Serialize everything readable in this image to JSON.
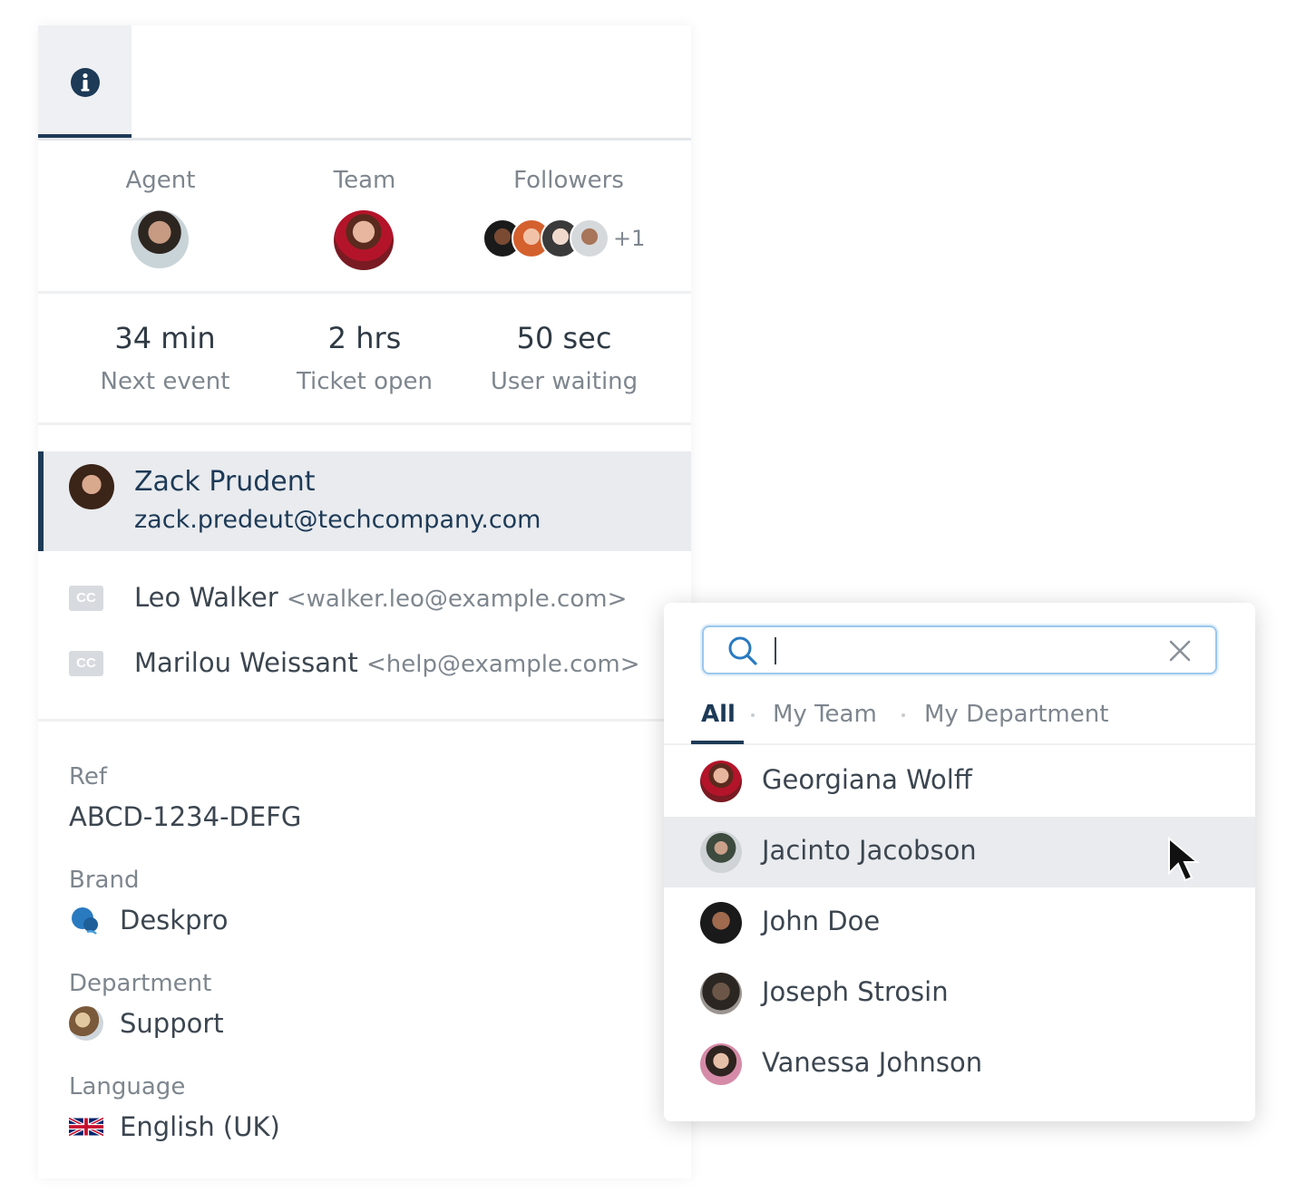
{
  "panel": {
    "tabs": [
      {
        "icon": "info-icon",
        "active": true
      }
    ],
    "people": {
      "agent_label": "Agent",
      "team_label": "Team",
      "followers_label": "Followers",
      "followers_more": "+1"
    },
    "metrics": [
      {
        "value": "34 min",
        "label": "Next event"
      },
      {
        "value": "2 hrs",
        "label": "Ticket open"
      },
      {
        "value": "50 sec",
        "label": "User waiting"
      }
    ],
    "requester": {
      "name": "Zack Prudent",
      "email": "zack.predeut@techcompany.com"
    },
    "cc": [
      {
        "badge": "CC",
        "name": "Leo Walker",
        "email": "<walker.leo@example.com>"
      },
      {
        "badge": "CC",
        "name": "Marilou Weissant",
        "email": "<help@example.com>"
      }
    ],
    "fields": {
      "ref_label": "Ref",
      "ref_value": "ABCD-1234-DEFG",
      "brand_label": "Brand",
      "brand_value": "Deskpro",
      "department_label": "Department",
      "department_value": "Support",
      "language_label": "Language",
      "language_value": "English (UK)"
    }
  },
  "dropdown": {
    "search": {
      "value": "",
      "placeholder": ""
    },
    "filter_tabs": [
      {
        "label": "All",
        "active": true
      },
      {
        "label": "My Team",
        "active": false
      },
      {
        "label": "My Department",
        "active": false
      }
    ],
    "agents": [
      {
        "name": "Georgiana Wolff",
        "hovered": false
      },
      {
        "name": "Jacinto Jacobson",
        "hovered": true
      },
      {
        "name": "John Doe",
        "hovered": false
      },
      {
        "name": "Joseph Strosin",
        "hovered": false
      },
      {
        "name": "Vanessa Johnson",
        "hovered": false
      }
    ]
  },
  "colors": {
    "accent": "#1d3a57",
    "muted_text": "#7e868e",
    "body_text": "#3c4650",
    "highlight_bg": "#e9ebee",
    "search_border": "#9cc7ec"
  }
}
